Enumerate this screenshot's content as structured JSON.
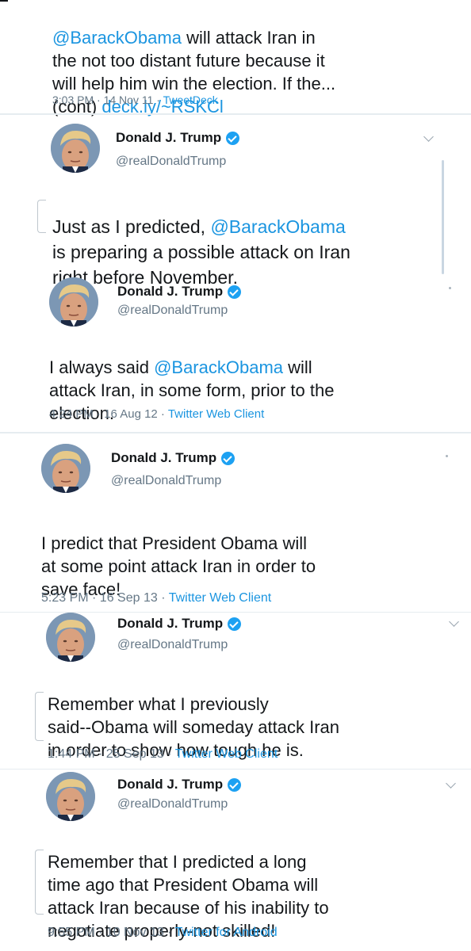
{
  "tweets": [
    {
      "text_mention": "@BarackObama",
      "text_rest": " will attack Iran in\nthe not too distant future because it\nwill help him win the election. If the...\n(cont) ",
      "link": "deck.ly/~RSKCl",
      "time": "3:03 PM · 14 Nov 11 · ",
      "source": "TweetDeck"
    },
    {
      "name": "Donald J. Trump",
      "handle": "@realDonaldTrump",
      "text_pre": "Just as I predicted, ",
      "text_mention": "@BarackObama",
      "text_rest": "\nis preparing a possible attack on Iran\nright before November."
    },
    {
      "name": "Donald J. Trump",
      "handle": "@realDonaldTrump",
      "text_pre": "I always said ",
      "text_mention": "@BarackObama",
      "text_rest": " will\nattack Iran, in some form, prior to the\nelection.",
      "time": "4:24 PM · 16 Aug 12 · ",
      "source": "Twitter Web Client"
    },
    {
      "name": "Donald J. Trump",
      "handle": "@realDonaldTrump",
      "text": "I predict that President Obama will\nat some point attack Iran in order to\nsave face!",
      "time": "5:23 PM · 16 Sep 13 · ",
      "source": "Twitter Web Client"
    },
    {
      "name": "Donald J. Trump",
      "handle": "@realDonaldTrump",
      "text": "Remember what I previously\nsaid--Obama will someday attack Iran\nin order to show how tough he is.",
      "time": "1:44 PM · 25 Sep 13 · ",
      "source": "Twitter Web Client"
    },
    {
      "name": "Donald J. Trump",
      "handle": "@realDonaldTrump",
      "text": "Remember that I predicted a long\ntime ago that President Obama will\nattack Iran because of his inability to\nnegotiate properly-not skilled!",
      "time": "9:55 PM · 10 Nov 13 · ",
      "source": "Twitter for Android"
    }
  ],
  "colors": {
    "link": "#1b95e0",
    "verified": "#1da1f2",
    "meta": "#657786"
  }
}
